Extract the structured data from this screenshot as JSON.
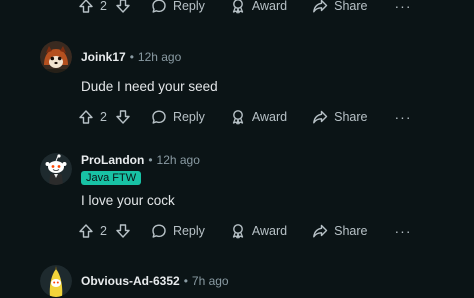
{
  "top_actions": {
    "vote_count": "2",
    "reply": "Reply",
    "award": "Award",
    "share": "Share",
    "more": "···"
  },
  "comments": [
    {
      "username": "Joink17",
      "separator": "•",
      "time": "12h ago",
      "flair": "",
      "body": "Dude I need your seed",
      "vote_count": "2",
      "reply": "Reply",
      "award": "Award",
      "share": "Share",
      "more": "···"
    },
    {
      "username": "ProLandon",
      "separator": "•",
      "time": "12h ago",
      "flair": "Java FTW",
      "body": "I love your cock",
      "vote_count": "2",
      "reply": "Reply",
      "award": "Award",
      "share": "Share",
      "more": "···"
    },
    {
      "username": "Obvious-Ad-6352",
      "separator": "•",
      "time": "7h ago"
    }
  ],
  "colors": {
    "background": "#0b1416",
    "flair_bg": "#18c2a5",
    "muted_text": "#8a9ba3"
  },
  "icons": [
    "upvote-icon",
    "downvote-icon",
    "reply-icon",
    "award-icon",
    "share-icon",
    "more-icon"
  ]
}
